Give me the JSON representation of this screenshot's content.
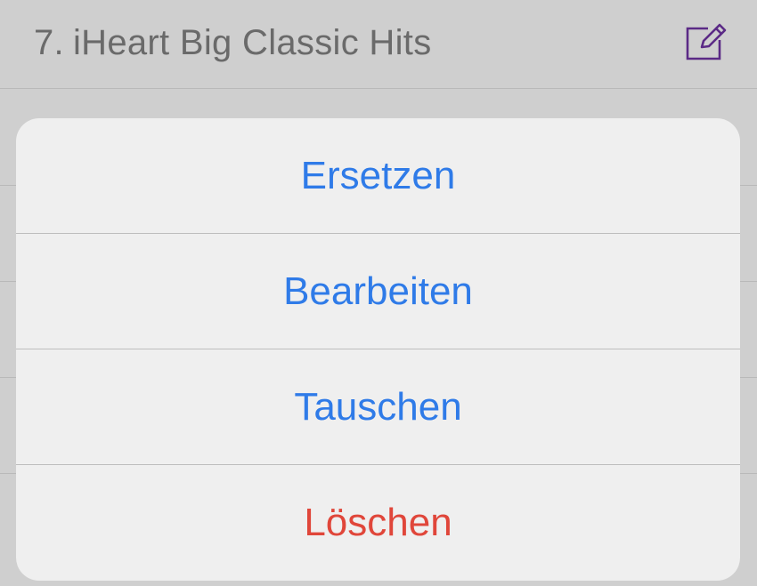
{
  "list": {
    "row": {
      "number": "7.",
      "title": "iHeart Big Classic Hits",
      "edit_icon": "compose-icon",
      "icon_color": "#5b2a86"
    }
  },
  "action_sheet": {
    "actions": [
      {
        "label": "Ersetzen",
        "style": "default",
        "color": "#2f7be8"
      },
      {
        "label": "Bearbeiten",
        "style": "default",
        "color": "#2f7be8"
      },
      {
        "label": "Tauschen",
        "style": "default",
        "color": "#2f7be8"
      },
      {
        "label": "Löschen",
        "style": "destructive",
        "color": "#e0463a"
      }
    ]
  }
}
